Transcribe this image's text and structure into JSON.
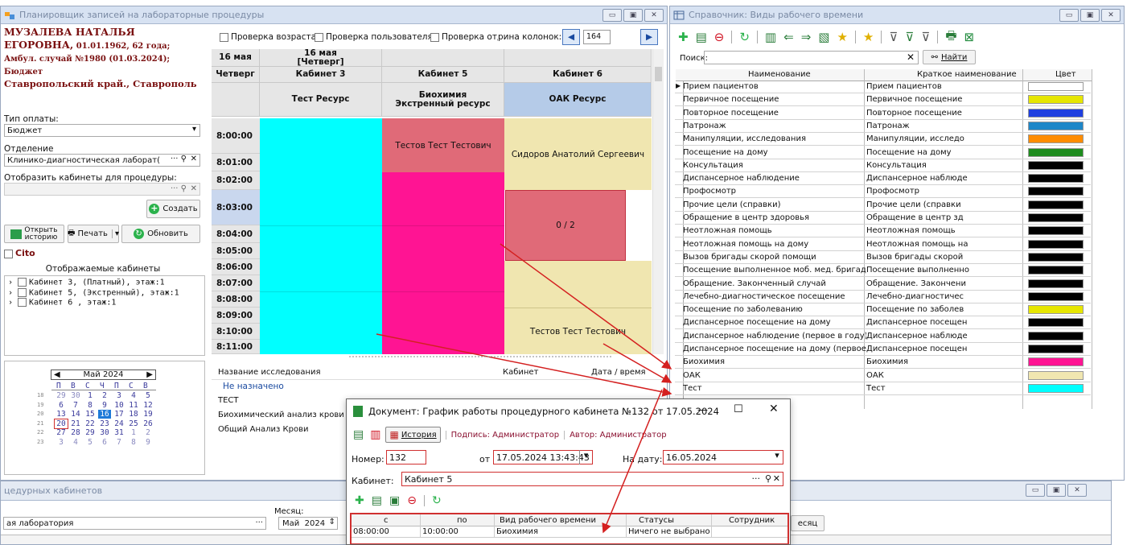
{
  "planner": {
    "title": "Планировщик записей на лабораторные процедуры",
    "patient_name": "МУЗАЛЕВА НАТАЛЬЯ ЕГОРОВНА,",
    "patient_info": " 01.01.1962, 62 года; Амбул. случай №1980 (01.03.2024); Бюджет",
    "patient_address": "Ставропольский край., Ставрополь",
    "payment_label": "Тип оплаты:",
    "payment_value": "Бюджет",
    "department_label": "Отделение",
    "department_value": "Клинико-диагностическая лаборат(",
    "show_rooms_label": "Отобразить кабинеты для процедуры:",
    "create_label": "Создать",
    "open_history_label_1": "Открыть",
    "open_history_label_2": "историю",
    "print_label": "Печать",
    "refresh_label": "Обновить",
    "cito_label": "Cito",
    "shown_rooms_label": "Отображаемые кабинеты",
    "rooms": [
      "Кабинет 3, (Платный), этаж:1",
      "Кабинет 5, (Экстренный), этаж:1",
      "Кабинет 6 , этаж:1"
    ],
    "calendar": {
      "month": "Май 2024",
      "weekdays": [
        "П",
        "В",
        "С",
        "Ч",
        "П",
        "С",
        "В"
      ],
      "weeks": [
        {
          "num": "18",
          "days": [
            "29",
            "30",
            "1",
            "2",
            "3",
            "4",
            "5"
          ]
        },
        {
          "num": "19",
          "days": [
            "6",
            "7",
            "8",
            "9",
            "10",
            "11",
            "12"
          ]
        },
        {
          "num": "20",
          "days": [
            "13",
            "14",
            "15",
            "16",
            "17",
            "18",
            "19"
          ]
        },
        {
          "num": "21",
          "days": [
            "20",
            "21",
            "22",
            "23",
            "24",
            "25",
            "26"
          ]
        },
        {
          "num": "22",
          "days": [
            "27",
            "28",
            "29",
            "30",
            "31",
            "1",
            "2"
          ]
        },
        {
          "num": "23",
          "days": [
            "3",
            "4",
            "5",
            "6",
            "7",
            "8",
            "9"
          ]
        }
      ]
    },
    "check_age": "Проверка возраста",
    "check_user": "Проверка пользователя",
    "check_dept": "Проверка отделения",
    "col_width_label": "рина колонок:",
    "col_width_value": "164",
    "day_header": "16 мая",
    "day_header_2": "Четверг",
    "date_header": "16 мая",
    "date_header_sub": "[Четверг]",
    "room_headers": [
      "Кабинет 3",
      "Кабинет 5",
      "Кабинет 6"
    ],
    "resource_headers": [
      "Тест Ресурс",
      "Биохимия Экстренный ресурс",
      "ОАК Ресурс"
    ],
    "times": [
      "8:00:00",
      "8:01:00",
      "8:02:00",
      "8:03:00",
      "8:04:00",
      "8:05:00",
      "8:06:00",
      "8:07:00",
      "8:08:00",
      "8:09:00",
      "8:10:00",
      "8:11:00"
    ],
    "appointments": {
      "room5_top": "Тестов Тест Тестович",
      "room6_top": "Сидоров Анатолий Сергеевич",
      "room6_slot": "0 / 2",
      "room6_bottom": "Тестов Тест Тестович"
    },
    "study_columns": [
      "Название исследования",
      "Кабинет",
      "Дата / время"
    ],
    "unassigned": "Не назначено",
    "studies": [
      "ТЕСТ",
      "Биохимический анализ крови",
      "Общий Анализ Крови"
    ]
  },
  "reference": {
    "title": "Справочник: Виды рабочего времени",
    "search_label": "Поиск:",
    "find_label": "Найти",
    "columns": [
      "Наименование",
      "Краткое наименование",
      "Цвет"
    ],
    "rows": [
      {
        "name": "Прием пациентов",
        "short": "Прием пациентов",
        "color": "#ffffff"
      },
      {
        "name": "Первичное посещение",
        "short": "Первичное посещение",
        "color": "#e6e600"
      },
      {
        "name": "Повторное посещение",
        "short": "Повторное посещение",
        "color": "#1f3fe0"
      },
      {
        "name": "Патронаж",
        "short": "Патронаж",
        "color": "#1e87c8"
      },
      {
        "name": "Манипуляции, исследования",
        "short": "Манипуляции, исследо",
        "color": "#ff8c00"
      },
      {
        "name": "Посещение на дому",
        "short": "Посещение на дому",
        "color": "#1e8c1e"
      },
      {
        "name": "Консультация",
        "short": "Консультация",
        "color": "#000000"
      },
      {
        "name": "Диспансерное наблюдение",
        "short": "Диспансерное наблюде",
        "color": "#000000"
      },
      {
        "name": "Профосмотр",
        "short": "Профосмотр",
        "color": "#000000"
      },
      {
        "name": "Прочие цели (справки)",
        "short": "Прочие цели (справки",
        "color": "#000000"
      },
      {
        "name": "Обращение в центр здоровья",
        "short": "Обращение в центр зд",
        "color": "#000000"
      },
      {
        "name": "Неотложная помощь",
        "short": "Неотложная помощь",
        "color": "#000000"
      },
      {
        "name": "Неотложная помощь на дому",
        "short": "Неотложная помощь на",
        "color": "#000000"
      },
      {
        "name": "Вызов бригады скорой помощи",
        "short": "Вызов бригады скорой",
        "color": "#000000"
      },
      {
        "name": "Посещение выполненное моб. мед. бригадой",
        "short": "Посещение выполненно",
        "color": "#000000"
      },
      {
        "name": "Обращение. Законченный случай",
        "short": "Обращение. Закончени",
        "color": "#000000"
      },
      {
        "name": "Лечебно-диагностическое посещение",
        "short": "Лечебно-диагностичес",
        "color": "#000000"
      },
      {
        "name": "Посещение по заболеванию",
        "short": "Посещение по заболев",
        "color": "#e6e600"
      },
      {
        "name": "Диспансерное посещение на дому",
        "short": "Диспансерное посещен",
        "color": "#000000"
      },
      {
        "name": "Диспансерное наблюдение (первое в году)",
        "short": "Диспансерное наблюде",
        "color": "#000000"
      },
      {
        "name": "Диспансерное посещение на дому (первое в",
        "short": "Диспансерное посещен",
        "color": "#000000"
      },
      {
        "name": "Биохимия",
        "short": "Биохимия",
        "color": "#ff1493"
      },
      {
        "name": "ОАК",
        "short": "ОАК",
        "color": "#f0e6b0"
      },
      {
        "name": "Тест",
        "short": "Тест",
        "color": "#00ffff"
      }
    ]
  },
  "document": {
    "title": "Документ: График работы процедурного кабинета №132 от 17.05.2024",
    "history_label": "История",
    "signature": "Подпись: Администратор",
    "author": "Автор: Администратор",
    "number_label": "Номер:",
    "number_value": "132",
    "from_label": "от",
    "from_value": "17.05.2024 13:43:43",
    "for_date_label": "На дату:",
    "for_date_value": "16.05.2024",
    "room_label": "Кабинет:",
    "room_value": "Кабинет 5",
    "columns": [
      "с",
      "по",
      "Вид рабочего времени",
      "Статусы",
      "Сотрудник"
    ],
    "row": {
      "from": "08:00:00",
      "to": "10:00:00",
      "type": "Биохимия",
      "status": "Ничего не выбрано",
      "employee": ""
    }
  },
  "bottom_window": {
    "title": "цедурных кабинетов",
    "lab_value": "ая лаборатория",
    "month_label": "Месяц:",
    "month_value": "Май",
    "year_value": "2024",
    "month_btn": "есяц"
  }
}
